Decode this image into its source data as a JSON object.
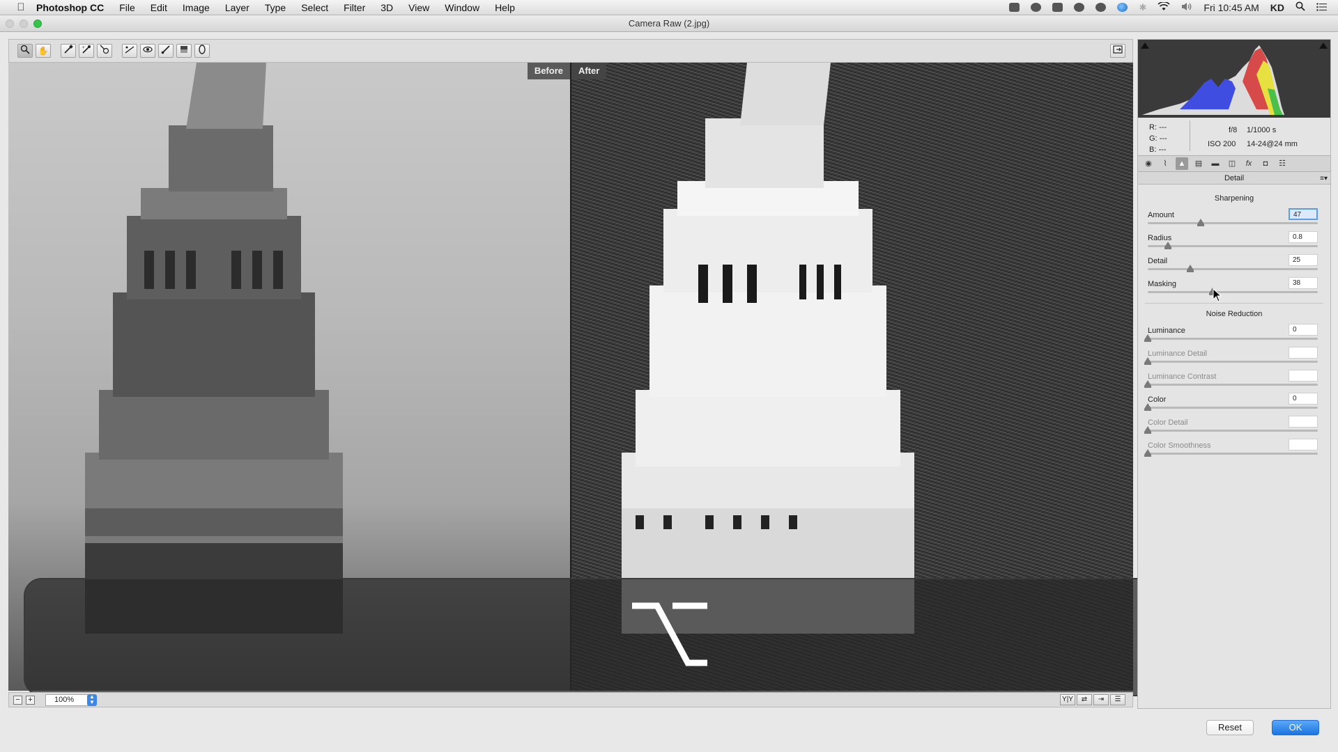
{
  "menubar": {
    "app_name": "Photoshop CC",
    "menus": [
      "File",
      "Edit",
      "Image",
      "Layer",
      "Type",
      "Select",
      "Filter",
      "3D",
      "View",
      "Window",
      "Help"
    ],
    "clock": "Fri 10:45 AM",
    "user": "KD"
  },
  "window": {
    "title": "Camera Raw (2.jpg)"
  },
  "toolbar": {
    "tools": [
      "zoom-tool",
      "hand-tool",
      "white-balance-tool",
      "color-sampler-tool",
      "targeted-adjustment-tool",
      "straighten-tool",
      "spot-removal-tool",
      "red-eye-removal-tool",
      "adjustment-brush-tool",
      "graduated-filter-tool",
      "radial-filter-tool"
    ]
  },
  "preview": {
    "before_label": "Before",
    "after_label": "After",
    "zoom_value": "100%",
    "overlay_key": "⌥"
  },
  "histogram": {
    "r_label": "R:",
    "r_value": "---",
    "g_label": "G:",
    "g_value": "---",
    "b_label": "B:",
    "b_value": "---",
    "aperture": "f/8",
    "shutter": "1/1000 s",
    "iso": "ISO 200",
    "lens": "14-24@24 mm"
  },
  "panel": {
    "title": "Detail",
    "sharpening_title": "Sharpening",
    "noise_title": "Noise Reduction",
    "sharpening": [
      {
        "label": "Amount",
        "value": "47",
        "level": 0.31,
        "focused": true
      },
      {
        "label": "Radius",
        "value": "0.8",
        "level": 0.12
      },
      {
        "label": "Detail",
        "value": "25",
        "level": 0.25
      },
      {
        "label": "Masking",
        "value": "38",
        "level": 0.38
      }
    ],
    "noise": [
      {
        "label": "Luminance",
        "value": "0",
        "level": 0.0
      },
      {
        "label": "Luminance Detail",
        "value": "",
        "level": 0.0,
        "disabled": true
      },
      {
        "label": "Luminance Contrast",
        "value": "",
        "level": 0.0,
        "disabled": true
      },
      {
        "label": "Color",
        "value": "0",
        "level": 0.0
      },
      {
        "label": "Color Detail",
        "value": "",
        "level": 0.0,
        "disabled": true
      },
      {
        "label": "Color Smoothness",
        "value": "",
        "level": 0.0,
        "disabled": true
      }
    ]
  },
  "buttons": {
    "reset": "Reset",
    "ok": "OK"
  },
  "colors": {
    "accent": "#1b74e0",
    "focus": "#5b9ee8"
  }
}
